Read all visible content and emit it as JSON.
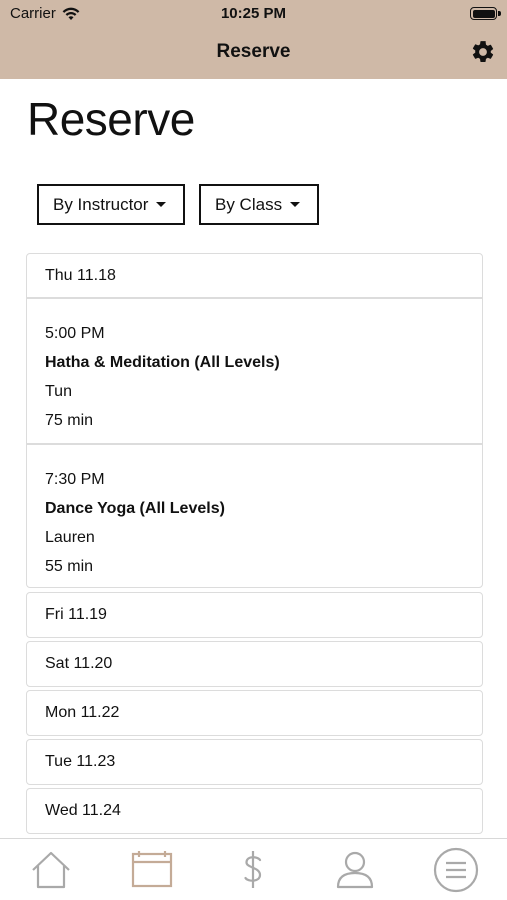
{
  "status_bar": {
    "carrier": "Carrier",
    "time": "10:25 PM"
  },
  "nav": {
    "title": "Reserve"
  },
  "page": {
    "title": "Reserve"
  },
  "filters": [
    {
      "label": "By Instructor"
    },
    {
      "label": "By Class"
    }
  ],
  "schedule": {
    "open_day": {
      "date": "Thu 11.18",
      "sessions": [
        {
          "time": "5:00 PM",
          "name": "Hatha & Meditation (All Levels)",
          "instructor": "Tun",
          "duration": "75 min"
        },
        {
          "time": "7:30 PM",
          "name": "Dance Yoga (All Levels)",
          "instructor": "Lauren",
          "duration": "55 min"
        }
      ]
    },
    "days": [
      "Fri 11.19",
      "Sat 11.20",
      "Mon 11.22",
      "Tue 11.23",
      "Wed 11.24"
    ]
  },
  "tabbar": {
    "tabs": [
      {
        "icon": "home-icon",
        "active": false
      },
      {
        "icon": "calendar-icon",
        "active": true
      },
      {
        "icon": "dollar-icon",
        "active": false
      },
      {
        "icon": "user-icon",
        "active": false
      },
      {
        "icon": "menu-icon",
        "active": false
      }
    ]
  },
  "colors": {
    "header_bg": "#cfb9a7",
    "active_tab": "#c4ab97",
    "inactive_tab": "#a9a9a9",
    "border": "#dcdcdc"
  }
}
